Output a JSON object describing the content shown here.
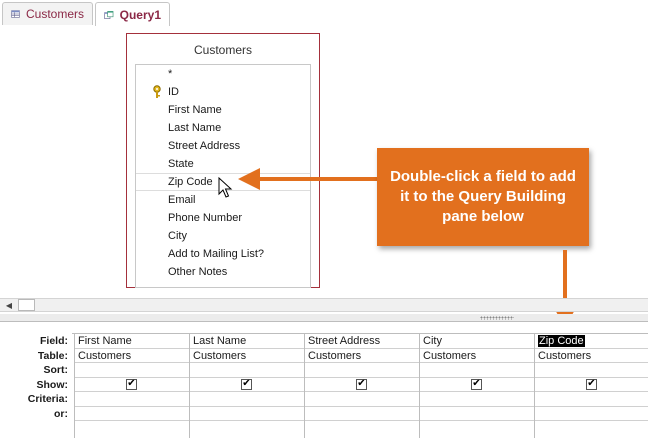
{
  "tabs": [
    {
      "label": "Customers",
      "icon": "table-icon",
      "active": false
    },
    {
      "label": "Query1",
      "icon": "query-icon",
      "active": true
    }
  ],
  "table_box": {
    "title": "Customers",
    "fields": [
      "*",
      "ID",
      "First Name",
      "Last Name",
      "Street Address",
      "State",
      "Zip Code",
      "Email",
      "Phone Number",
      "City",
      "Add to Mailing List?",
      "Other Notes"
    ],
    "primary_key": "ID",
    "hovered_field": "Zip Code"
  },
  "callout": {
    "text": "Double-click a field to add it to the Query Building pane below",
    "color": "#e2701e"
  },
  "grid": {
    "row_labels": [
      "Field:",
      "Table:",
      "Sort:",
      "Show:",
      "Criteria:",
      "or:"
    ],
    "columns": [
      {
        "field": "First Name",
        "table": "Customers",
        "show": true
      },
      {
        "field": "Last Name",
        "table": "Customers",
        "show": true
      },
      {
        "field": "Street Address",
        "table": "Customers",
        "show": true
      },
      {
        "field": "City",
        "table": "Customers",
        "show": true
      },
      {
        "field": "Zip Code",
        "table": "Customers",
        "show": true,
        "selected": true
      }
    ]
  },
  "colors": {
    "tab_text": "#8b2846",
    "table_border": "#a4303b",
    "accent": "#e2701e"
  }
}
